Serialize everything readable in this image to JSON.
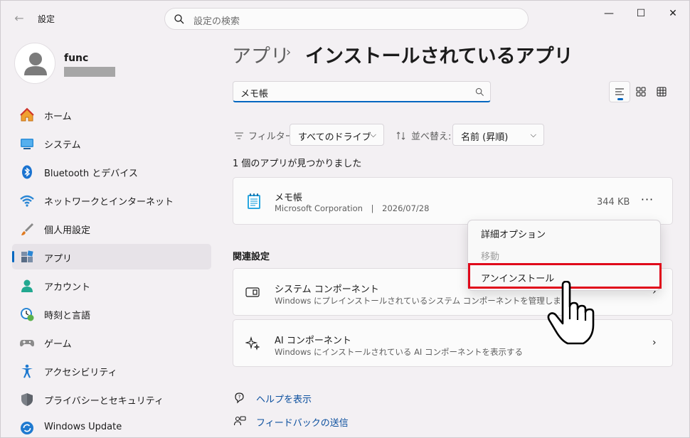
{
  "window": {
    "title": "設定",
    "search_placeholder": "設定の検索",
    "controls": {
      "minimize": "—",
      "maximize": "☐",
      "close": "✕"
    }
  },
  "profile": {
    "name": "func"
  },
  "sidebar": {
    "items": [
      {
        "label": "ホーム",
        "icon": "home-icon"
      },
      {
        "label": "システム",
        "icon": "system-icon"
      },
      {
        "label": "Bluetooth とデバイス",
        "icon": "bluetooth-icon"
      },
      {
        "label": "ネットワークとインターネット",
        "icon": "wifi-icon"
      },
      {
        "label": "個人用設定",
        "icon": "brush-icon"
      },
      {
        "label": "アプリ",
        "icon": "apps-icon",
        "active": true
      },
      {
        "label": "アカウント",
        "icon": "account-icon"
      },
      {
        "label": "時刻と言語",
        "icon": "time-language-icon"
      },
      {
        "label": "ゲーム",
        "icon": "gamepad-icon"
      },
      {
        "label": "アクセシビリティ",
        "icon": "accessibility-icon"
      },
      {
        "label": "プライバシーとセキュリティ",
        "icon": "shield-icon"
      },
      {
        "label": "Windows Update",
        "icon": "update-icon"
      }
    ]
  },
  "breadcrumb": {
    "parent": "アプリ",
    "separator": "›",
    "current": "インストールされているアプリ"
  },
  "filter": {
    "value": "メモ帳"
  },
  "toolbar": {
    "filter_label": "フィルター:",
    "filter_value": "すべてのドライブ",
    "sort_label": "並べ替え:",
    "sort_value": "名前 (昇順)"
  },
  "result_count": "1 個のアプリが見つかりました",
  "app": {
    "name": "メモ帳",
    "publisher": "Microsoft Corporation",
    "separator": "|",
    "date": "2026/07/28",
    "size": "344 KB",
    "more": "···"
  },
  "context_menu": {
    "items": [
      {
        "label": "詳細オプション",
        "enabled": true
      },
      {
        "label": "移動",
        "enabled": false
      },
      {
        "label": "アンインストール",
        "enabled": true,
        "highlighted": true
      }
    ]
  },
  "related": {
    "title": "関連設定",
    "cards": [
      {
        "title": "システム コンポーネント",
        "subtitle": "Windows にプレインストールされているシステム コンポーネントを管理します",
        "icon": "system-component-icon"
      },
      {
        "title": "AI コンポーネント",
        "subtitle": "Windows にインストールされている AI コンポーネントを表示する",
        "icon": "ai-sparkle-icon"
      }
    ]
  },
  "links": [
    {
      "label": "ヘルプを表示",
      "icon": "help-icon"
    },
    {
      "label": "フィードバックの送信",
      "icon": "feedback-icon"
    }
  ],
  "colors": {
    "accent": "#0067c0",
    "highlight_box": "#e0081a",
    "link": "#0b4f9e"
  }
}
